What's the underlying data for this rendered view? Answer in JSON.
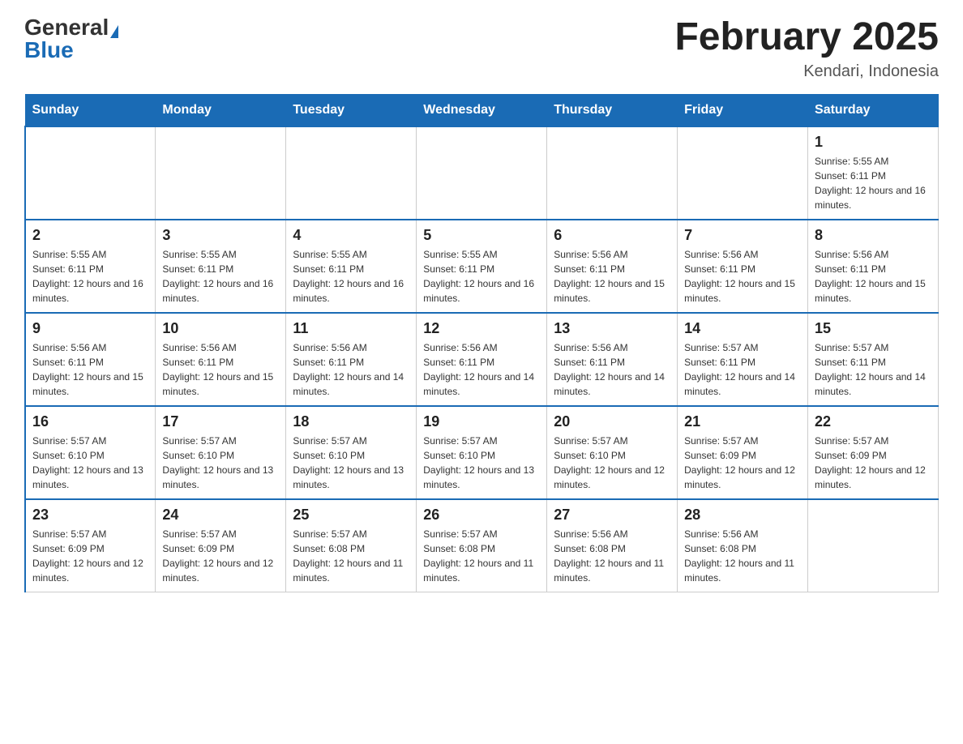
{
  "header": {
    "logo_general": "General",
    "logo_blue": "Blue",
    "month_title": "February 2025",
    "location": "Kendari, Indonesia"
  },
  "days_of_week": [
    "Sunday",
    "Monday",
    "Tuesday",
    "Wednesday",
    "Thursday",
    "Friday",
    "Saturday"
  ],
  "weeks": [
    [
      {
        "day": "",
        "sunrise": "",
        "sunset": "",
        "daylight": ""
      },
      {
        "day": "",
        "sunrise": "",
        "sunset": "",
        "daylight": ""
      },
      {
        "day": "",
        "sunrise": "",
        "sunset": "",
        "daylight": ""
      },
      {
        "day": "",
        "sunrise": "",
        "sunset": "",
        "daylight": ""
      },
      {
        "day": "",
        "sunrise": "",
        "sunset": "",
        "daylight": ""
      },
      {
        "day": "",
        "sunrise": "",
        "sunset": "",
        "daylight": ""
      },
      {
        "day": "1",
        "sunrise": "Sunrise: 5:55 AM",
        "sunset": "Sunset: 6:11 PM",
        "daylight": "Daylight: 12 hours and 16 minutes."
      }
    ],
    [
      {
        "day": "2",
        "sunrise": "Sunrise: 5:55 AM",
        "sunset": "Sunset: 6:11 PM",
        "daylight": "Daylight: 12 hours and 16 minutes."
      },
      {
        "day": "3",
        "sunrise": "Sunrise: 5:55 AM",
        "sunset": "Sunset: 6:11 PM",
        "daylight": "Daylight: 12 hours and 16 minutes."
      },
      {
        "day": "4",
        "sunrise": "Sunrise: 5:55 AM",
        "sunset": "Sunset: 6:11 PM",
        "daylight": "Daylight: 12 hours and 16 minutes."
      },
      {
        "day": "5",
        "sunrise": "Sunrise: 5:55 AM",
        "sunset": "Sunset: 6:11 PM",
        "daylight": "Daylight: 12 hours and 16 minutes."
      },
      {
        "day": "6",
        "sunrise": "Sunrise: 5:56 AM",
        "sunset": "Sunset: 6:11 PM",
        "daylight": "Daylight: 12 hours and 15 minutes."
      },
      {
        "day": "7",
        "sunrise": "Sunrise: 5:56 AM",
        "sunset": "Sunset: 6:11 PM",
        "daylight": "Daylight: 12 hours and 15 minutes."
      },
      {
        "day": "8",
        "sunrise": "Sunrise: 5:56 AM",
        "sunset": "Sunset: 6:11 PM",
        "daylight": "Daylight: 12 hours and 15 minutes."
      }
    ],
    [
      {
        "day": "9",
        "sunrise": "Sunrise: 5:56 AM",
        "sunset": "Sunset: 6:11 PM",
        "daylight": "Daylight: 12 hours and 15 minutes."
      },
      {
        "day": "10",
        "sunrise": "Sunrise: 5:56 AM",
        "sunset": "Sunset: 6:11 PM",
        "daylight": "Daylight: 12 hours and 15 minutes."
      },
      {
        "day": "11",
        "sunrise": "Sunrise: 5:56 AM",
        "sunset": "Sunset: 6:11 PM",
        "daylight": "Daylight: 12 hours and 14 minutes."
      },
      {
        "day": "12",
        "sunrise": "Sunrise: 5:56 AM",
        "sunset": "Sunset: 6:11 PM",
        "daylight": "Daylight: 12 hours and 14 minutes."
      },
      {
        "day": "13",
        "sunrise": "Sunrise: 5:56 AM",
        "sunset": "Sunset: 6:11 PM",
        "daylight": "Daylight: 12 hours and 14 minutes."
      },
      {
        "day": "14",
        "sunrise": "Sunrise: 5:57 AM",
        "sunset": "Sunset: 6:11 PM",
        "daylight": "Daylight: 12 hours and 14 minutes."
      },
      {
        "day": "15",
        "sunrise": "Sunrise: 5:57 AM",
        "sunset": "Sunset: 6:11 PM",
        "daylight": "Daylight: 12 hours and 14 minutes."
      }
    ],
    [
      {
        "day": "16",
        "sunrise": "Sunrise: 5:57 AM",
        "sunset": "Sunset: 6:10 PM",
        "daylight": "Daylight: 12 hours and 13 minutes."
      },
      {
        "day": "17",
        "sunrise": "Sunrise: 5:57 AM",
        "sunset": "Sunset: 6:10 PM",
        "daylight": "Daylight: 12 hours and 13 minutes."
      },
      {
        "day": "18",
        "sunrise": "Sunrise: 5:57 AM",
        "sunset": "Sunset: 6:10 PM",
        "daylight": "Daylight: 12 hours and 13 minutes."
      },
      {
        "day": "19",
        "sunrise": "Sunrise: 5:57 AM",
        "sunset": "Sunset: 6:10 PM",
        "daylight": "Daylight: 12 hours and 13 minutes."
      },
      {
        "day": "20",
        "sunrise": "Sunrise: 5:57 AM",
        "sunset": "Sunset: 6:10 PM",
        "daylight": "Daylight: 12 hours and 12 minutes."
      },
      {
        "day": "21",
        "sunrise": "Sunrise: 5:57 AM",
        "sunset": "Sunset: 6:09 PM",
        "daylight": "Daylight: 12 hours and 12 minutes."
      },
      {
        "day": "22",
        "sunrise": "Sunrise: 5:57 AM",
        "sunset": "Sunset: 6:09 PM",
        "daylight": "Daylight: 12 hours and 12 minutes."
      }
    ],
    [
      {
        "day": "23",
        "sunrise": "Sunrise: 5:57 AM",
        "sunset": "Sunset: 6:09 PM",
        "daylight": "Daylight: 12 hours and 12 minutes."
      },
      {
        "day": "24",
        "sunrise": "Sunrise: 5:57 AM",
        "sunset": "Sunset: 6:09 PM",
        "daylight": "Daylight: 12 hours and 12 minutes."
      },
      {
        "day": "25",
        "sunrise": "Sunrise: 5:57 AM",
        "sunset": "Sunset: 6:08 PM",
        "daylight": "Daylight: 12 hours and 11 minutes."
      },
      {
        "day": "26",
        "sunrise": "Sunrise: 5:57 AM",
        "sunset": "Sunset: 6:08 PM",
        "daylight": "Daylight: 12 hours and 11 minutes."
      },
      {
        "day": "27",
        "sunrise": "Sunrise: 5:56 AM",
        "sunset": "Sunset: 6:08 PM",
        "daylight": "Daylight: 12 hours and 11 minutes."
      },
      {
        "day": "28",
        "sunrise": "Sunrise: 5:56 AM",
        "sunset": "Sunset: 6:08 PM",
        "daylight": "Daylight: 12 hours and 11 minutes."
      },
      {
        "day": "",
        "sunrise": "",
        "sunset": "",
        "daylight": ""
      }
    ]
  ]
}
